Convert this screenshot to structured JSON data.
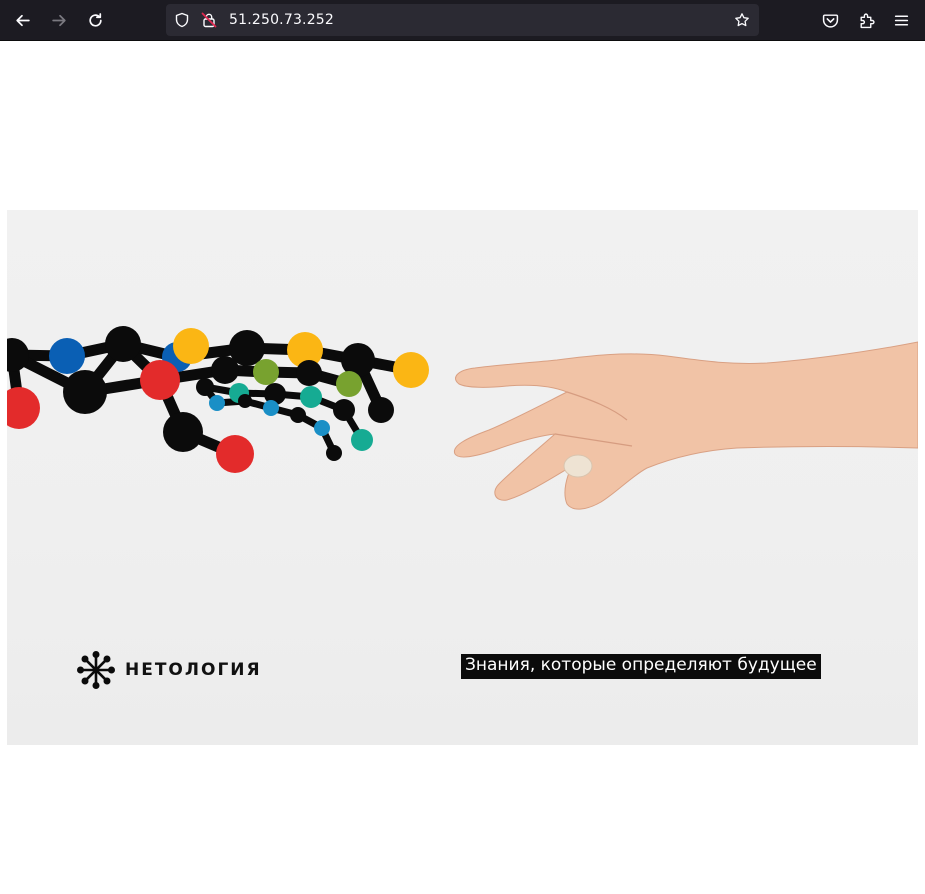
{
  "browser": {
    "url": "51.250.73.252",
    "icons": [
      "back-arrow-icon",
      "forward-arrow-icon",
      "reload-icon",
      "shield-icon",
      "insecure-lock-icon",
      "bookmark-star-icon",
      "pocket-icon",
      "extensions-icon",
      "menu-icon"
    ],
    "colors": {
      "toolbar": "#1c1b22",
      "urlbar": "#2b2a33",
      "text": "#fbfbfe"
    }
  },
  "banner": {
    "logo_text": "НЕТОЛОГИЯ",
    "tagline": "Знания, которые определяют будущее",
    "colors": {
      "blue": "#0a5fb4",
      "red": "#e32b2b",
      "yellow": "#fbb614",
      "green": "#78a22f",
      "teal": "#16ab93",
      "cyan": "#1a8fc6",
      "black": "#0b0b0b"
    }
  }
}
